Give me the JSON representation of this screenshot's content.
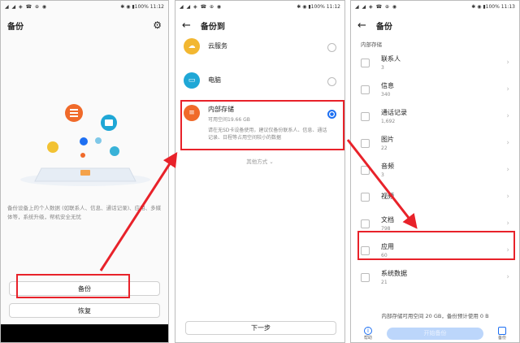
{
  "status_left": "◢ ◢ ◈ ☎ ⊕ ◉",
  "status_right": "✱ ◉ ▮100% 11:12",
  "status_right3": "✱ ◉ ▮100% 11:13",
  "screen1": {
    "title": "备份",
    "description": "备份设备上的个人数据 (如联系人、信息、通话记录)、应用、多媒体等，系统升级，帮机安全无忧",
    "backup_label": "备份",
    "restore_label": "恢复"
  },
  "screen2": {
    "title": "备份到",
    "options": [
      {
        "title": "云服务",
        "subtitle": "",
        "color": "#f2b731",
        "icon": "cloud-icon",
        "selected": false
      },
      {
        "title": "电脑",
        "subtitle": "",
        "color": "#1fa7d6",
        "icon": "monitor-icon",
        "selected": false
      },
      {
        "title": "内部存储",
        "subtitle": "可用空间19.66 GB",
        "note": "请在无SD卡设备使用，建议仅备份联系人、信息、通话记录、日程等占用空间较小的数据",
        "color": "#f06a2a",
        "icon": "storage-icon",
        "selected": true
      }
    ],
    "more_label": "其他方式 ⌄",
    "next_label": "下一步"
  },
  "screen3": {
    "title": "备份",
    "section": "内部存储",
    "items": [
      {
        "name": "联系人",
        "count": "3"
      },
      {
        "name": "信息",
        "count": "340"
      },
      {
        "name": "通话记录",
        "count": "1,692"
      },
      {
        "name": "图片",
        "count": "22"
      },
      {
        "name": "音频",
        "count": "3"
      },
      {
        "name": "视频",
        "count": ""
      },
      {
        "name": "文档",
        "count": "798"
      },
      {
        "name": "应用",
        "count": "60"
      },
      {
        "name": "系统数据",
        "count": "21"
      }
    ],
    "summary": "内部存储可用空间 20 GB，备份预计使用 0 B",
    "left_icon_label": "帮助",
    "start_label": "开始备份",
    "right_icon_label": "备份"
  },
  "accent_color": "#e8222a"
}
